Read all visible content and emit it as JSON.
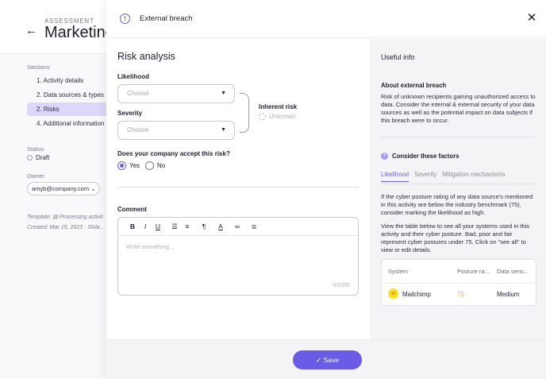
{
  "background": {
    "eyebrow": "ASSESSMENT",
    "title": "Marketing",
    "sections_label": "Sections",
    "sections": [
      {
        "label": "1. Activity details"
      },
      {
        "label": "2. Data sources & types"
      },
      {
        "label": "2. Risks"
      },
      {
        "label": "4. Additional information"
      }
    ],
    "status_label": "Status",
    "status_value": "Draft",
    "owner_label": "Owner",
    "owner_value": "amyb@company.com",
    "template_line": "Template: ▤ Processing activit",
    "created_line": "Created: Mar 19, 2023 · Shila ."
  },
  "drawer": {
    "title": "External breach",
    "left": {
      "heading": "Risk analysis",
      "likelihood_label": "Likelihood",
      "likelihood_placeholder": "Choose",
      "severity_label": "Severity",
      "severity_placeholder": "Choose",
      "inherent_label": "Inherent risk",
      "inherent_value": "Unknown",
      "accept_question": "Does your company accept this risk?",
      "options": {
        "yes": "Yes",
        "no": "No"
      },
      "selected": "yes",
      "comment_label": "Comment",
      "comment_placeholder": "Write something...",
      "counter": "0/1000"
    },
    "right": {
      "heading": "Useful info",
      "about_title": "About external breach",
      "about_text": "Risk of unknown recipients gaining unauthorized access to data. Consider the internal & external security of your data sources as well as the potential impact on data subjects if this breach were to occur.",
      "consider_title": "Consider these factors",
      "tabs": [
        "Likelihood",
        "Severity",
        "Mitigation mechanisms"
      ],
      "active_tab": "Likelihood",
      "paragraph1": "If the cyber posture rating of any data source's mentioned in this activity are below the industry benchmark (75), consider marking the likelihood as high.",
      "paragraph2": "View the table below to see all your systems used in this activity and their cyber posture. Bad, poor and fair represent cyber postures under 75. Click on \"see all\" to view or edit details.",
      "table": {
        "headers": [
          "System",
          "Posture ra...",
          "Data sens..."
        ],
        "rows": [
          {
            "system": "Mailchimp",
            "posture": "75",
            "sensitivity": "Medium"
          }
        ]
      }
    },
    "save_label": "Save"
  },
  "colors": {
    "accent": "#6b5ce7",
    "posture_value": "#f5a623",
    "active_section_bg": "#dcd8fb"
  },
  "icons": {
    "back": "arrow-left-icon",
    "header": "info-circle-icon",
    "close": "close-icon",
    "consider": "question-circle-icon",
    "save": "check-icon"
  }
}
